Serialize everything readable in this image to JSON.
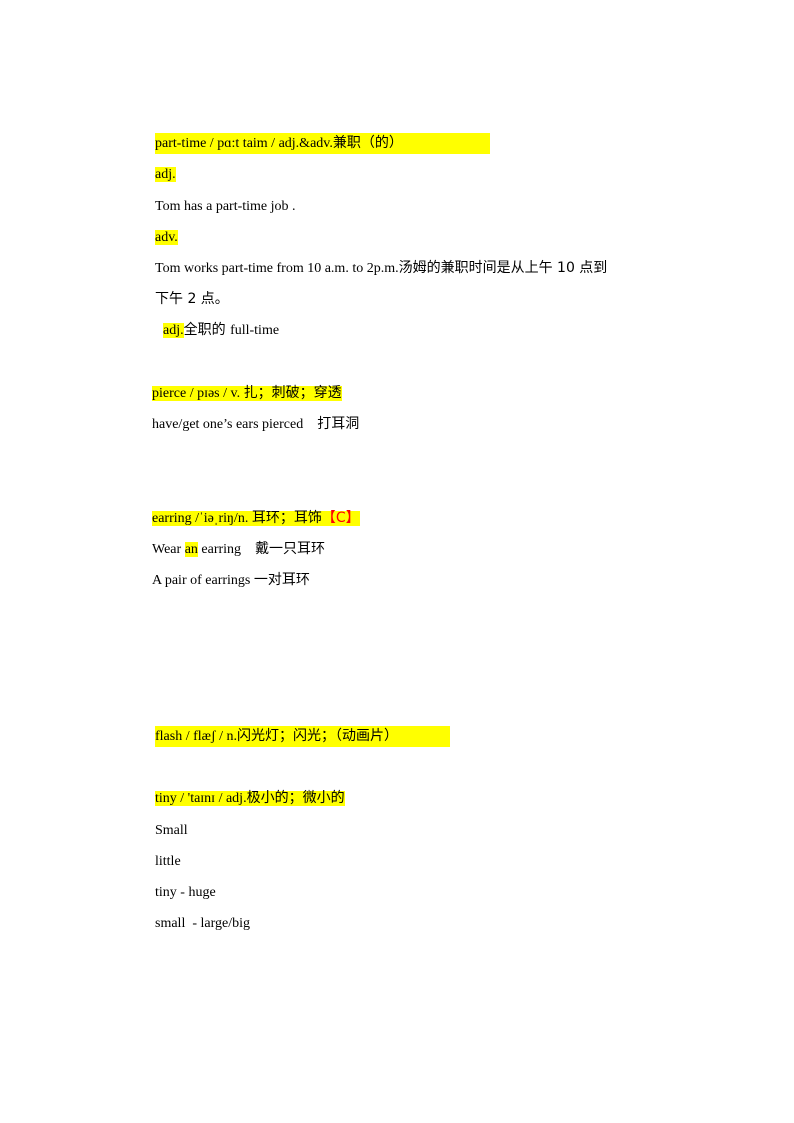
{
  "entries": {
    "part_time": {
      "headword_line": " part-time / pɑ:t taim / adj.&adv.",
      "headword_cn": "兼职（的）",
      "adj_label": "adj.",
      "adj_example": "Tom has a part-time job .",
      "adv_label": "adv.",
      "adv_example_en": "Tom works part-time from 10 a.m. to 2p.m.",
      "adv_example_cn_1": "汤姆的兼职时间是从上午  10 点到",
      "adv_example_cn_2": "下午 2 点。",
      "opposite_label": "adj.",
      "opposite_cn": "全职的 ",
      "opposite_en": "full-time"
    },
    "pierce": {
      "headword_line": "pierce / pɪəs / v. ",
      "headword_cn": "扎；刺破；穿透",
      "example_en": "have/get one’s ears pierced",
      "example_cn": "打耳洞"
    },
    "earring": {
      "headword_line": "earring /ˈiəˌriŋ/n. ",
      "headword_cn": "耳环；耳饰",
      "tag": "【C】",
      "example1_pre": "Wear ",
      "example1_hl": "an",
      "example1_post": " earring",
      "example1_cn": "戴一只耳环",
      "example2_en": "A pair of earrings ",
      "example2_cn": "一对耳环"
    },
    "flash": {
      "headword_line": "flash / flæʃ / n.",
      "headword_cn": "闪光灯；闪光；（动画片）"
    },
    "tiny": {
      "headword_line": "tiny / 'taɪnɪ / adj.",
      "headword_cn": "极小的；微小的",
      "notes": [
        "Small",
        "little",
        "tiny - huge",
        "small  - large/big"
      ]
    }
  },
  "colors": {
    "highlight": "#ffff00",
    "tag_red": "#ff0000"
  }
}
